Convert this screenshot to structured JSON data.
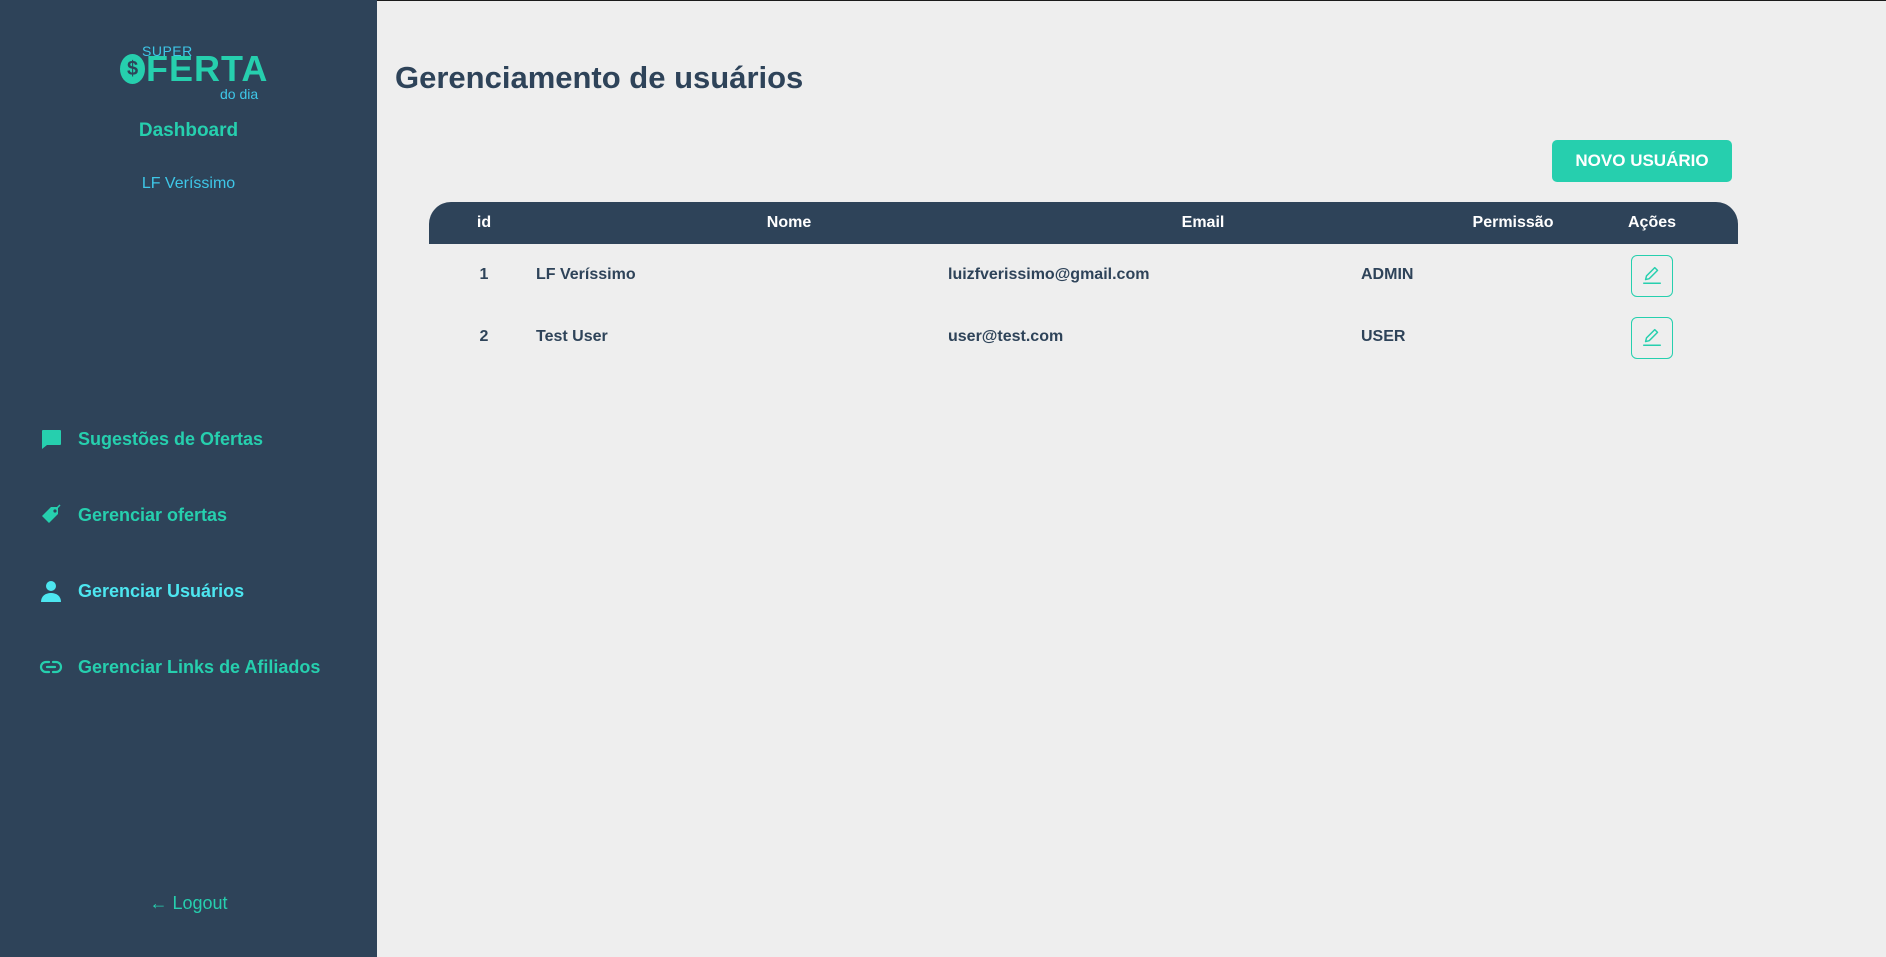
{
  "logo": {
    "super": "SUPER",
    "coin": "$",
    "ferta": "FERTA",
    "do_dia": "do dia"
  },
  "sidebar": {
    "title": "Dashboard",
    "user_name": "LF Veríssimo",
    "items": [
      {
        "label": "Sugestões de Ofertas",
        "icon": "chat-bubble-icon",
        "active": false
      },
      {
        "label": "Gerenciar ofertas",
        "icon": "price-tag-icon",
        "active": false
      },
      {
        "label": "Gerenciar Usuários",
        "icon": "person-icon",
        "active": true
      },
      {
        "label": "Gerenciar Links de Afiliados",
        "icon": "link-icon",
        "active": false
      }
    ],
    "logout": "← Logout"
  },
  "main": {
    "title": "Gerenciamento de usuários",
    "new_user_button": "NOVO USUÁRIO",
    "table": {
      "headers": {
        "id": "id",
        "name": "Nome",
        "email": "Email",
        "permission": "Permissão",
        "actions": "Ações"
      },
      "rows": [
        {
          "id": "1",
          "name": "LF Veríssimo",
          "email": "luizfverissimo@gmail.com",
          "permission": "ADMIN"
        },
        {
          "id": "2",
          "name": "Test User",
          "email": "user@test.com",
          "permission": "USER"
        }
      ]
    }
  },
  "colors": {
    "sidebar_bg": "#2e4359",
    "accent": "#26cfae",
    "accent_light": "#3ec7e8",
    "active_nav": "#4de6f0",
    "page_bg": "#eeeeee"
  }
}
